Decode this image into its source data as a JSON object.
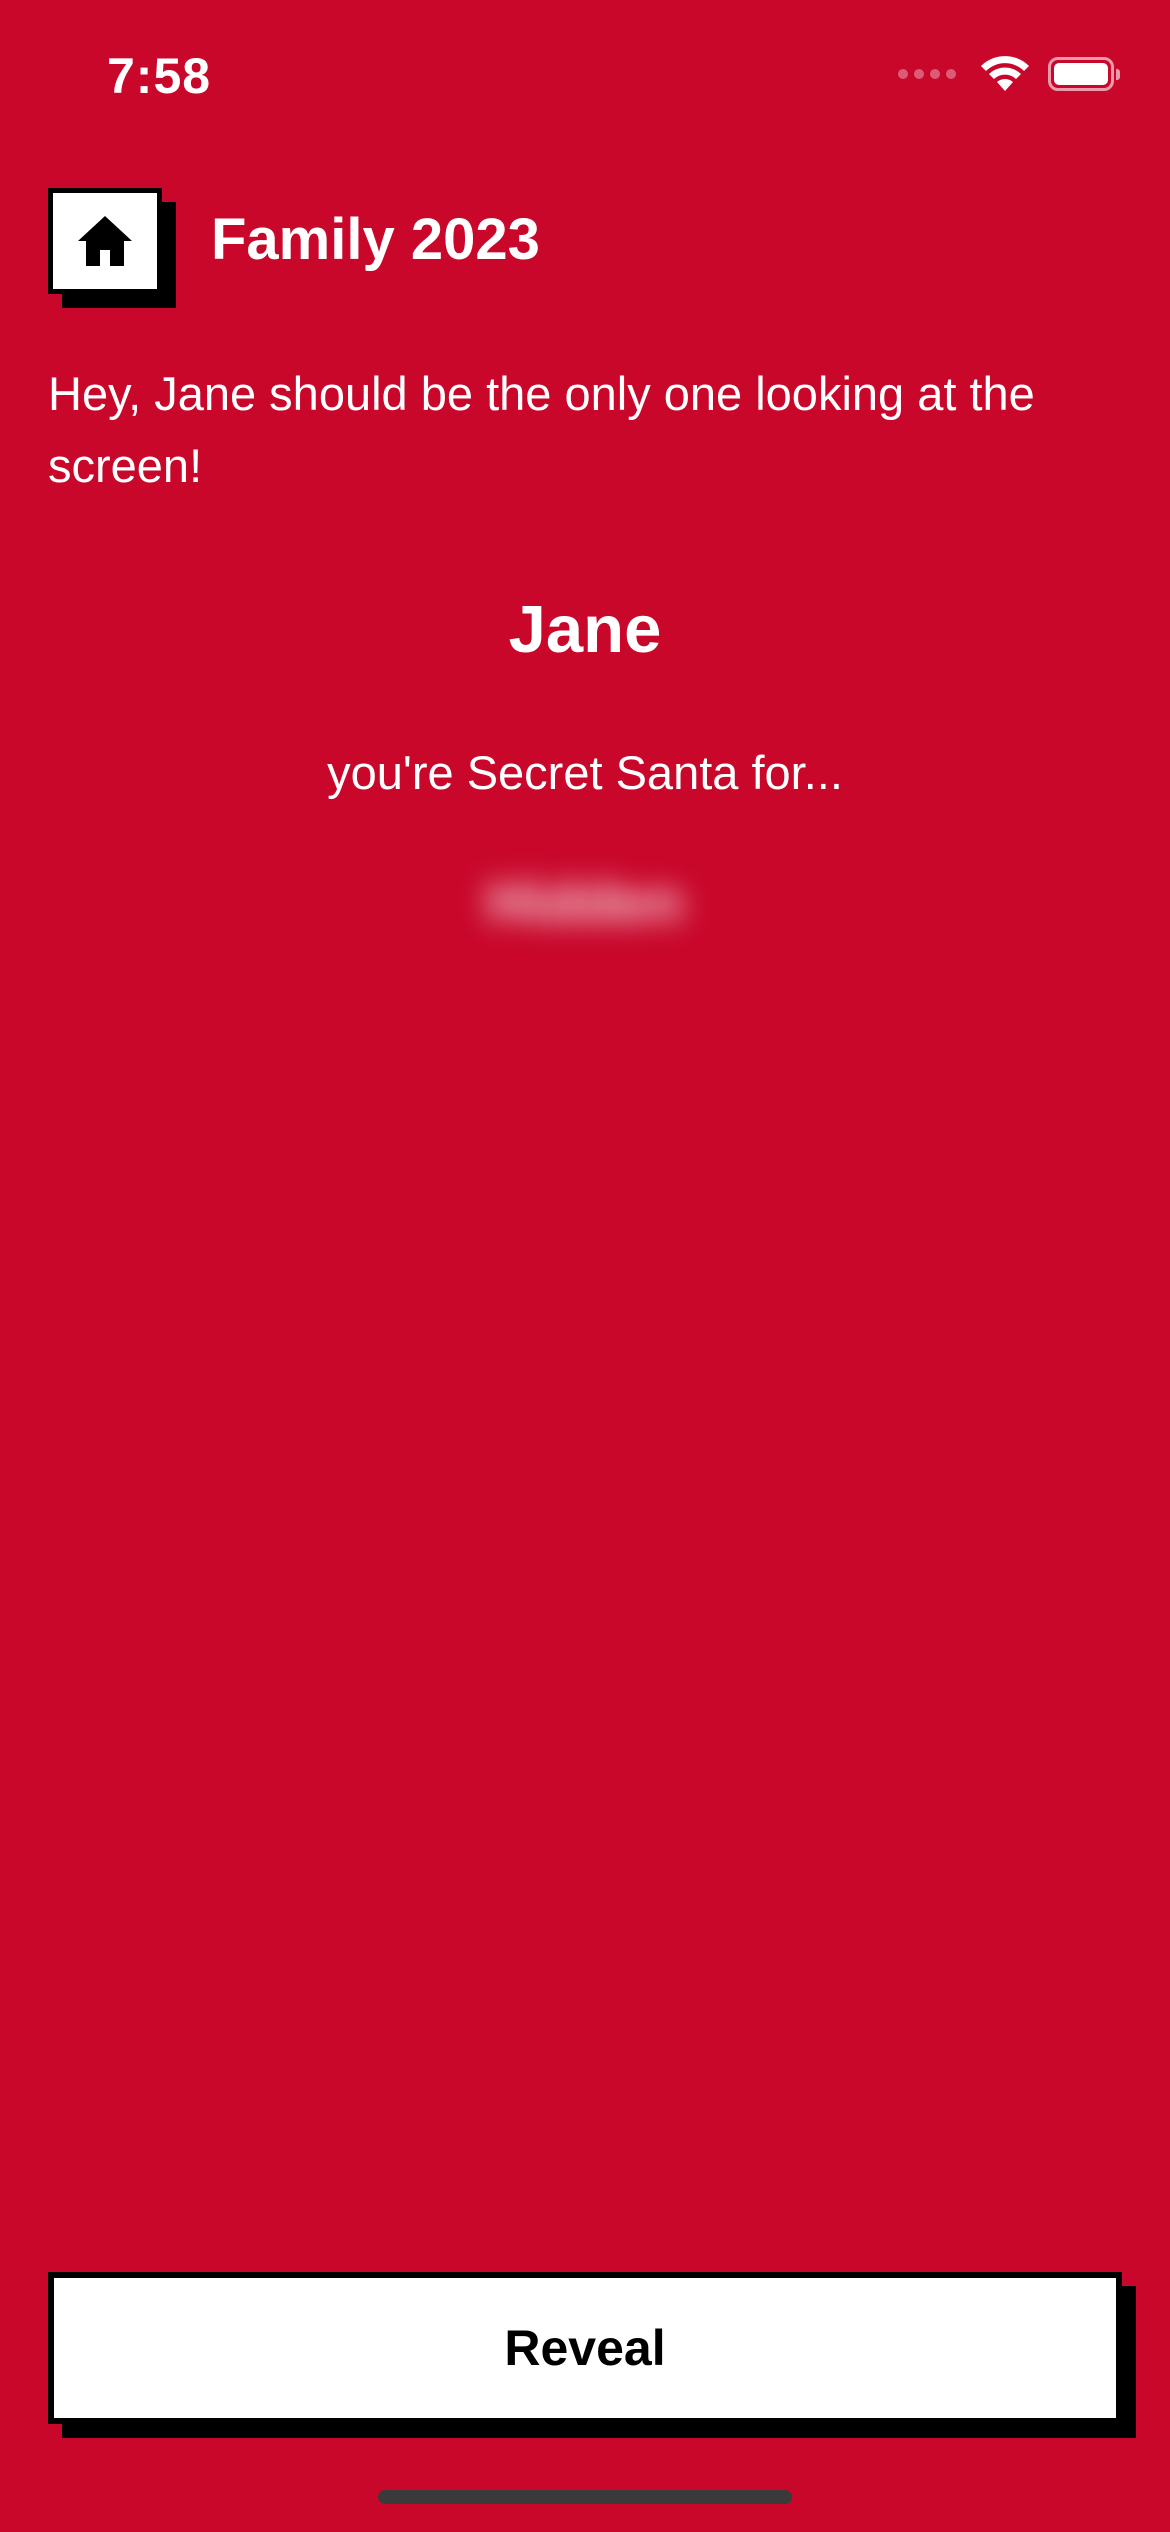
{
  "status_bar": {
    "time": "7:58",
    "icons": [
      "cellular-signal-icon",
      "wifi-icon",
      "battery-icon"
    ]
  },
  "header": {
    "home_icon": "home-icon",
    "title": "Family 2023"
  },
  "main": {
    "warning": "Hey, Jane should be the only one looking at the screen!",
    "person_name": "Jane",
    "santa_prompt": "you're Secret Santa for...",
    "hidden_assignee": "Hidden"
  },
  "footer": {
    "reveal_label": "Reveal"
  },
  "colors": {
    "background": "#c8072b",
    "button_bg": "#ffffff",
    "button_border": "#000000",
    "text": "#ffffff"
  }
}
